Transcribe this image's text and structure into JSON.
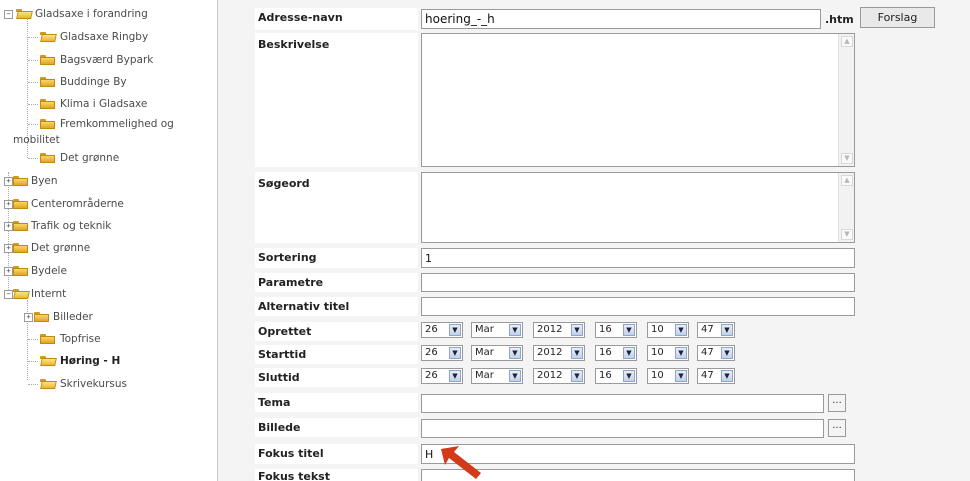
{
  "tree": {
    "items": [
      {
        "label": "Gladsaxe i forandring"
      },
      {
        "label": "Gladsaxe Ringby"
      },
      {
        "label": "Bagsværd Bypark"
      },
      {
        "label": "Buddinge By"
      },
      {
        "label": "Klima i Gladsaxe"
      },
      {
        "label": "Fremkommelighed og"
      },
      {
        "label": "mobilitet"
      },
      {
        "label": "Det grønne"
      },
      {
        "label": "Byen"
      },
      {
        "label": "Centerområderne"
      },
      {
        "label": "Trafik og teknik"
      },
      {
        "label": "Det grønne"
      },
      {
        "label": "Bydele"
      },
      {
        "label": "Internt"
      },
      {
        "label": "Billeder"
      },
      {
        "label": "Topfrise"
      },
      {
        "label": "Høring - H"
      },
      {
        "label": "Skrivekursus"
      }
    ]
  },
  "form": {
    "adresse_label": "Adresse-navn",
    "adresse_value": "hoering_-_h",
    "htm": ".htm",
    "forslag": "Forslag",
    "beskrivelse_label": "Beskrivelse",
    "soegeord_label": "Søgeord",
    "sortering_label": "Sortering",
    "sortering_value": "1",
    "parametre_label": "Parametre",
    "alt_titel_label": "Alternativ titel",
    "oprettet_label": "Oprettet",
    "starttid_label": "Starttid",
    "sluttid_label": "Sluttid",
    "tema_label": "Tema",
    "billede_label": "Billede",
    "fokus_titel_label": "Fokus titel",
    "fokus_titel_value": "H",
    "fokus_tekst_label": "Fokus tekst",
    "browse": "...",
    "date": {
      "day": "26",
      "month": "Mar",
      "year": "2012",
      "hour": "16",
      "minute": "10",
      "second": "47"
    }
  },
  "colors": {
    "pointer_arrow": "#d23a1a",
    "folder": "#e8b62a"
  }
}
